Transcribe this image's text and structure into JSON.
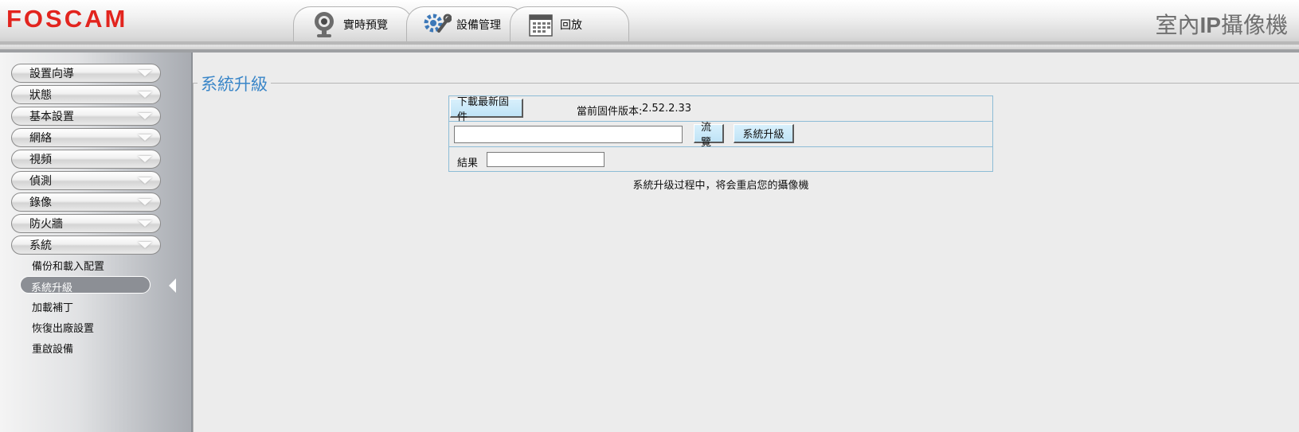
{
  "header": {
    "logo_text": "FOSCAM",
    "product_title_pre": "室內",
    "product_title_ip": "IP",
    "product_title_post": "攝像機",
    "tabs": [
      {
        "label": "實時預覽",
        "icon": "webcam-icon"
      },
      {
        "label": "設備管理",
        "icon": "gears-icon"
      },
      {
        "label": "回放",
        "icon": "calendar-icon"
      }
    ]
  },
  "sidebar": {
    "menus": [
      {
        "label": "設置向導"
      },
      {
        "label": "狀態"
      },
      {
        "label": "基本設置"
      },
      {
        "label": "網絡"
      },
      {
        "label": "視頻"
      },
      {
        "label": "偵測"
      },
      {
        "label": "錄像"
      },
      {
        "label": "防火牆"
      },
      {
        "label": "系統"
      }
    ],
    "system_submenu": [
      {
        "label": "備份和載入配置"
      },
      {
        "label": "系統升級",
        "active": true
      },
      {
        "label": "加載補丁"
      },
      {
        "label": "恢復出廠設置"
      },
      {
        "label": "重啟設備"
      }
    ]
  },
  "main": {
    "section_title": "系統升級",
    "download_button": "下載最新固件",
    "firmware_version_label": "當前固件版本:",
    "firmware_version_value": "2.52.2.33",
    "file_input_value": "",
    "browse_button": "流覽",
    "upgrade_button": "系統升級",
    "result_label": "結果",
    "result_value": "",
    "notice": "系統升级过程中，将会重启您的攝像機"
  },
  "colors": {
    "brand_red": "#e2241e",
    "section_title_blue": "#3a86c8",
    "table_border": "#8dbcd6",
    "button_fill": "#c6e8f8"
  }
}
